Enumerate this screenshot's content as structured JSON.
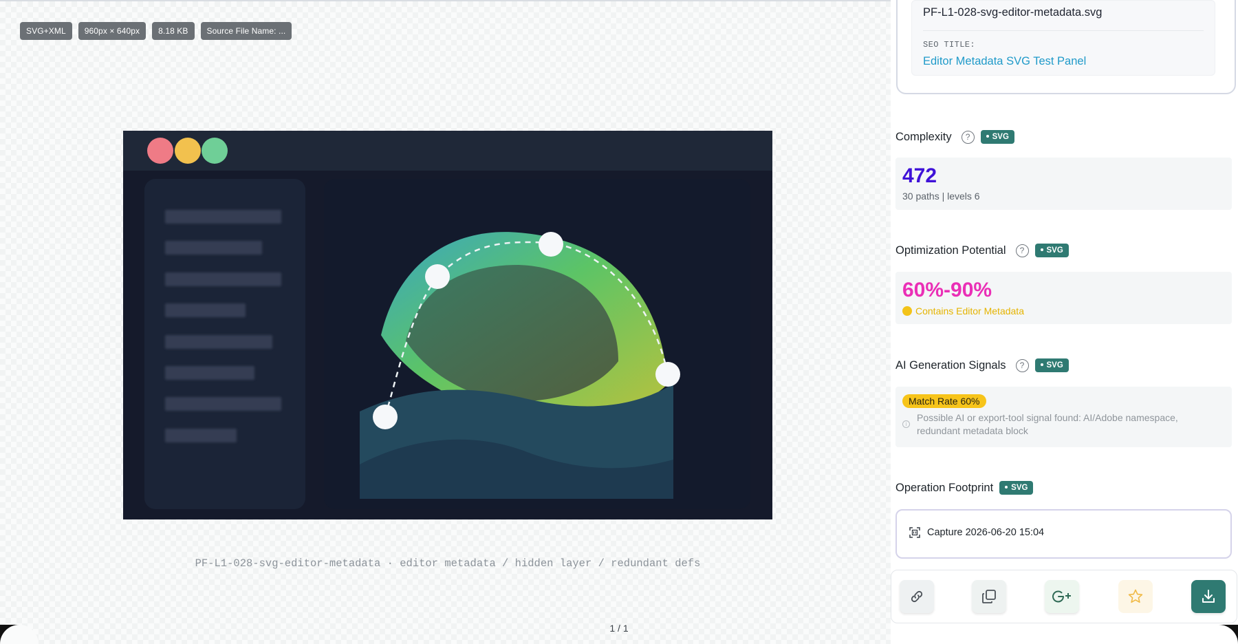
{
  "preview": {
    "badges": [
      {
        "label": "SVG+XML"
      },
      {
        "label": "960px × 640px"
      },
      {
        "label": "8.18 KB"
      },
      {
        "label": "Source File Name: ..."
      }
    ],
    "caption": "PF-L1-028-svg-editor-metadata · editor metadata / hidden layer / redundant defs",
    "pager": "1 / 1",
    "artwork": {
      "window_dots": [
        "#ef7b86",
        "#f2c14e",
        "#6fcf97"
      ],
      "bg": "#151a2b",
      "titlebar": "#1f2838"
    }
  },
  "panel": {
    "file": {
      "filename": "PF-L1-028-svg-editor-metadata.svg",
      "seo_label": "SEO TITLE:",
      "seo_value": "Editor Metadata SVG Test Panel"
    },
    "complexity": {
      "title": "Complexity",
      "tag": "SVG",
      "value": "472",
      "detail": "30 paths | levels 6"
    },
    "optimization": {
      "title": "Optimization Potential",
      "tag": "SVG",
      "value": "60%-90%",
      "flag": "Contains Editor Metadata"
    },
    "ai_signals": {
      "title": "AI Generation Signals",
      "tag": "SVG",
      "match": "Match Rate 60%",
      "text": "Possible AI or export-tool signal found: AI/Adobe namespace, redundant metadata block"
    },
    "footprint": {
      "title": "Operation Footprint",
      "tag": "SVG",
      "capture": "Capture 2026-06-20 15:04"
    },
    "actions": {
      "link": "link-icon",
      "copy": "copy-icon",
      "google": "google-plus-icon",
      "star": "star-icon",
      "download": "download-icon"
    },
    "colors": {
      "accent": "#2f7a72",
      "complexity": "#3f12d8",
      "optimization": "#ea2fb6",
      "warning": "#f7c41a",
      "seo": "#1f9ac9"
    }
  }
}
